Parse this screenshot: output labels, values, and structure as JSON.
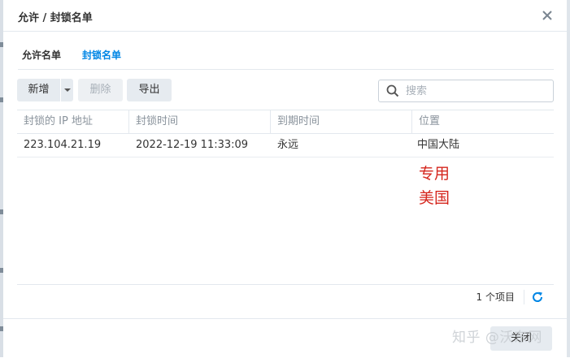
{
  "dialog": {
    "title": "允许 / 封锁名单"
  },
  "tabs": [
    {
      "label": "允许名单",
      "active": false
    },
    {
      "label": "封锁名单",
      "active": true
    }
  ],
  "toolbar": {
    "add_label": "新增",
    "delete_label": "删除",
    "export_label": "导出",
    "delete_disabled": true
  },
  "search": {
    "placeholder": "搜索",
    "value": ""
  },
  "table": {
    "columns": [
      "封锁的 IP 地址",
      "封锁时间",
      "到期时间",
      "位置"
    ],
    "rows": [
      [
        "223.104.21.19",
        "2022-12-19 11:33:09",
        "永远",
        "中国大陆"
      ]
    ]
  },
  "annotation": {
    "line1": "专用",
    "line2": "美国",
    "color": "#d5261d"
  },
  "footer": {
    "count_text": "1 个项目"
  },
  "actions": {
    "close_label": "关闭"
  },
  "watermark": {
    "text": "知乎 @沃东网"
  },
  "colors": {
    "accent": "#0086e5",
    "button_bg": "#e6ebf0"
  }
}
